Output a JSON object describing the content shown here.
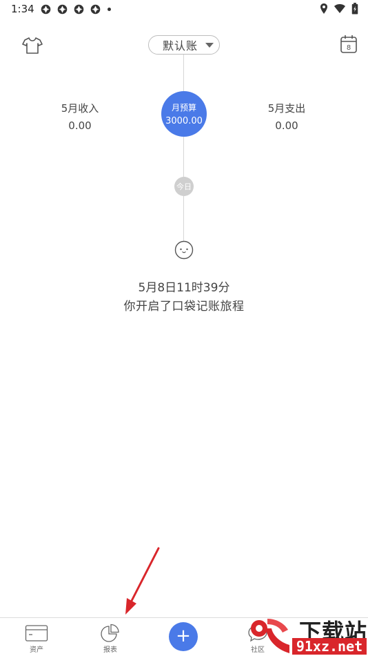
{
  "status_bar": {
    "time": "1:34",
    "notification_icons": [
      "app-notification-icon",
      "app-notification-icon",
      "app-notification-icon",
      "app-notification-icon"
    ],
    "right_icons": [
      "location-icon",
      "wifi-icon",
      "battery-icon"
    ]
  },
  "header": {
    "book_selector": "默认账",
    "calendar_day": "8"
  },
  "summary": {
    "income_label": "5月收入",
    "income_value": "0.00",
    "budget_label": "月预算",
    "budget_value": "3000.00",
    "expense_label": "5月支出",
    "expense_value": "0.00"
  },
  "timeline": {
    "today_label": "今日",
    "journey_date": "5月8日11时39分",
    "journey_text": "你开启了口袋记账旅程"
  },
  "bottom_nav": {
    "assets_label": "资产",
    "reports_label": "报表",
    "add_label": "+",
    "community_label": "社区"
  },
  "watermark": {
    "top_text": "下载站",
    "bottom_text": "91xz.net"
  },
  "colors": {
    "accent": "#4a7ae8",
    "annotation_arrow": "#d9262b",
    "today_badge": "#cfcfcf"
  }
}
